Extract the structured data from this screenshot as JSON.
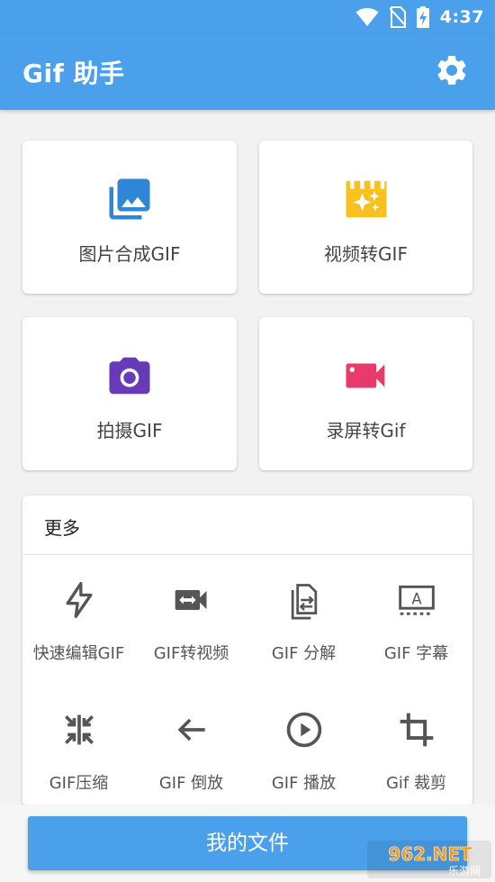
{
  "status": {
    "time": "4:37"
  },
  "appbar": {
    "title": "Gif 助手"
  },
  "cards": [
    {
      "label": "图片合成GIF",
      "icon": "image-collection-icon",
      "color": "#2f86d6"
    },
    {
      "label": "视频转GIF",
      "icon": "movie-sparkle-icon",
      "color": "#f8c11d"
    },
    {
      "label": "拍摄GIF",
      "icon": "camera-icon",
      "color": "#673ab7"
    },
    {
      "label": "录屏转Gif",
      "icon": "videocam-icon",
      "color": "#ea3a6c"
    }
  ],
  "more": {
    "title": "更多",
    "tools": [
      {
        "label": "快速编辑GIF",
        "icon": "flash-icon"
      },
      {
        "label": "GIF转视频",
        "icon": "video-convert-icon"
      },
      {
        "label": "GIF 分解",
        "icon": "file-split-icon"
      },
      {
        "label": "GIF 字幕",
        "icon": "subtitles-icon"
      },
      {
        "label": "GIF压缩",
        "icon": "compress-icon"
      },
      {
        "label": "GIF 倒放",
        "icon": "arrow-left-icon"
      },
      {
        "label": "GIF 播放",
        "icon": "play-circle-icon"
      },
      {
        "label": "Gif 裁剪",
        "icon": "crop-icon"
      }
    ]
  },
  "bottom": {
    "my_files_label": "我的文件"
  },
  "watermark": {
    "text": "962.NET",
    "subtext": "乐游网"
  },
  "colors": {
    "primary": "#4aa0ea",
    "icon_gray": "#555555"
  }
}
